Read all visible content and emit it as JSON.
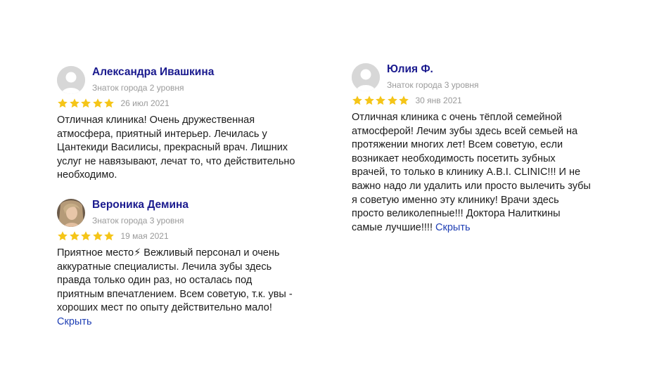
{
  "reviews": [
    {
      "name": "Александра Ивашкина",
      "level": "Знаток города 2 уровня",
      "rating": 5,
      "date": "26 июл 2021",
      "text": "Отличная клиника! Очень дружественная атмосфера, приятный интерьер. Лечилась у Цантекиди Василисы, прекрасный врач. Лишних услуг не навязывают, лечат то, что действительно необходимо."
    },
    {
      "name": "Вероника Демина",
      "level": "Знаток города 3 уровня",
      "rating": 5,
      "date": "19 мая 2021",
      "text": "Приятное место⚡ Вежливый персонал и очень аккуратные специалисты. Лечила зубы здесь правда только один раз, но осталась под приятным впечатлением. Всем советую, т.к. увы - хороших мест по опыту действительно мало!",
      "hide_label": "Скрыть"
    },
    {
      "name": "Юлия Ф.",
      "level": "Знаток города 3 уровня",
      "rating": 5,
      "date": "30 янв 2021",
      "text": "Отличная клиника с очень тёплой семейной атмосферой! Лечим зубы здесь всей семьей на протяжении многих лет! Всем советую, если возникает необходимость посетить зубных врачей, то только в клинику A.B.I. CLINIC!!! И не важно надо ли удалить или просто вылечить зубы я советую именно эту клинику! Врачи здесь просто великолепные!!! Доктора Налиткины самые лучшие!!!!",
      "hide_label": "Скрыть"
    }
  ],
  "colors": {
    "name": "#1a1a8e",
    "star": "#f5c518",
    "link": "#1f3fb4",
    "muted": "#9a9a9a"
  }
}
